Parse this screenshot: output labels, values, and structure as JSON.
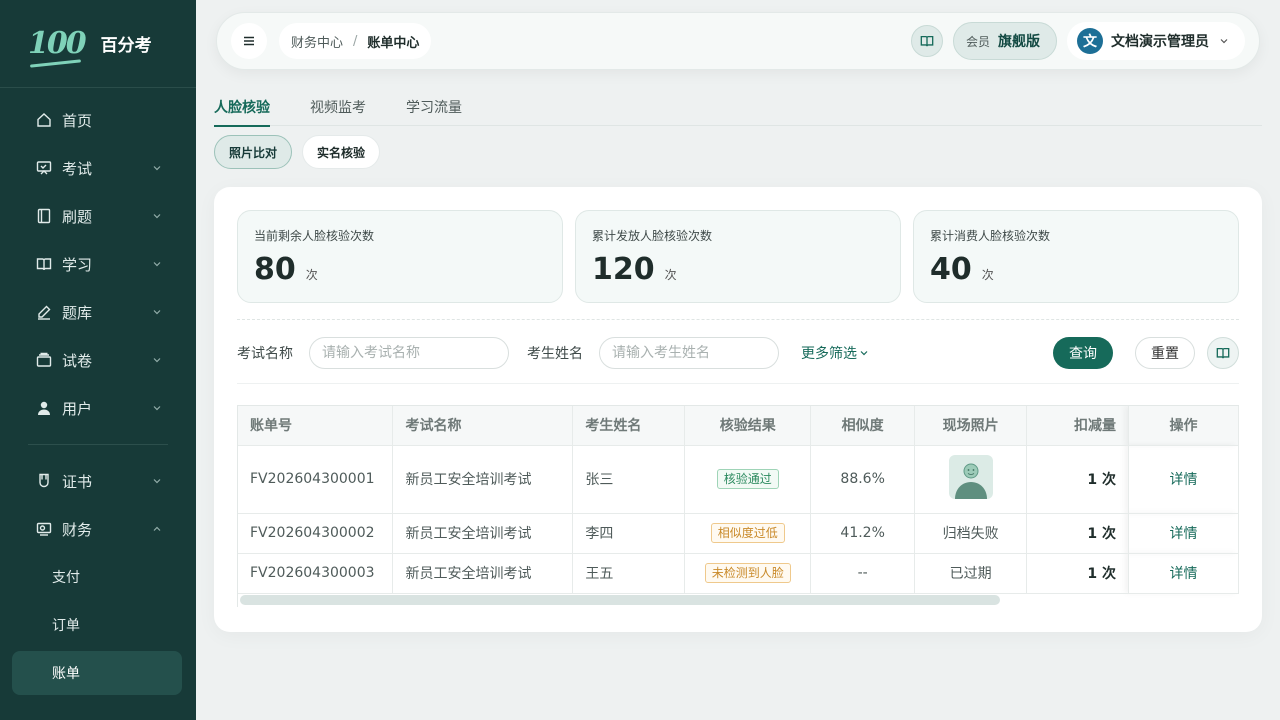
{
  "brand": {
    "logo": "100",
    "name": "百分考"
  },
  "sidebar": {
    "items": [
      {
        "label": "首页",
        "icon": "home-icon"
      },
      {
        "label": "考试",
        "icon": "exam-icon"
      },
      {
        "label": "刷题",
        "icon": "notebook-icon"
      },
      {
        "label": "学习",
        "icon": "book-icon"
      },
      {
        "label": "题库",
        "icon": "pen-icon"
      },
      {
        "label": "试卷",
        "icon": "paper-stack-icon"
      },
      {
        "label": "用户",
        "icon": "user-icon"
      },
      {
        "label": "证书",
        "icon": "certificate-icon"
      },
      {
        "label": "财务",
        "icon": "finance-icon"
      }
    ],
    "finance_sub": [
      "支付",
      "订单",
      "账单"
    ]
  },
  "header": {
    "breadcrumb_parent": "财务中心",
    "breadcrumb_sep": "/",
    "breadcrumb_current": "账单中心",
    "plan_label": "会员",
    "plan_name": "旗舰版",
    "avatar_char": "文",
    "user_name": "文档演示管理员"
  },
  "tabs": [
    "人脸核验",
    "视频监考",
    "学习流量"
  ],
  "subtabs": [
    "照片比对",
    "实名核验"
  ],
  "stats": [
    {
      "label": "当前剩余人脸核验次数",
      "value": "80",
      "unit": "次"
    },
    {
      "label": "累计发放人脸核验次数",
      "value": "120",
      "unit": "次"
    },
    {
      "label": "累计消费人脸核验次数",
      "value": "40",
      "unit": "次"
    }
  ],
  "filters": {
    "exam_label": "考试名称",
    "exam_placeholder": "请输入考试名称",
    "name_label": "考生姓名",
    "name_placeholder": "请输入考生姓名",
    "more": "更多筛选",
    "query": "查询",
    "reset": "重置"
  },
  "table": {
    "headers": [
      "账单号",
      "考试名称",
      "考生姓名",
      "核验结果",
      "相似度",
      "现场照片",
      "扣减量",
      "操作"
    ],
    "rows": [
      {
        "bill": "FV202604300001",
        "exam": "新员工安全培训考试",
        "name": "张三",
        "result": "核验通过",
        "similarity": "88.6%",
        "photo": "",
        "deduct": "1 次",
        "action": "详情"
      },
      {
        "bill": "FV202604300002",
        "exam": "新员工安全培训考试",
        "name": "李四",
        "result": "相似度过低",
        "similarity": "41.2%",
        "photo": "归档失败",
        "deduct": "1 次",
        "action": "详情"
      },
      {
        "bill": "FV202604300003",
        "exam": "新员工安全培训考试",
        "name": "王五",
        "result": "未检测到人脸",
        "similarity": "--",
        "photo": "已过期",
        "deduct": "1 次",
        "action": "详情"
      }
    ]
  },
  "colors": {
    "sidebar_bg": "#173a38",
    "accent": "#166a5a",
    "success": "#2c8a5f",
    "warning": "#c98a2a"
  }
}
